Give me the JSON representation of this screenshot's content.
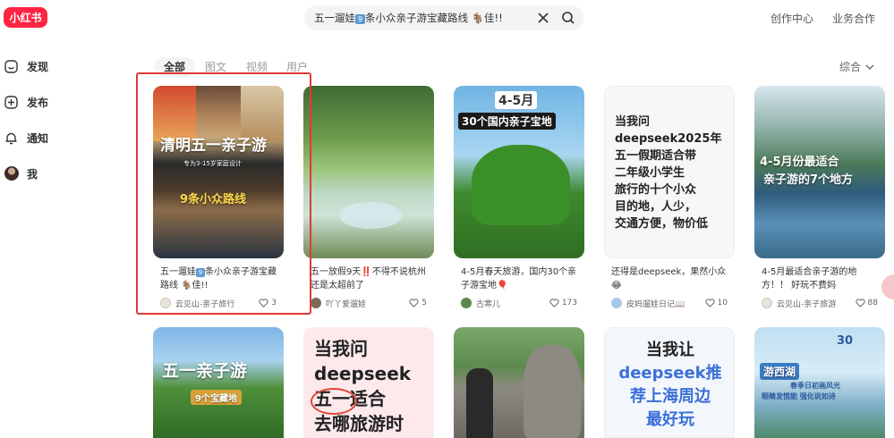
{
  "header": {
    "logo": "小红书",
    "search_value": "五一遛娃9条小众亲子游宝藏路线🐐佳!!",
    "search_value_parts": [
      "五一遛娃",
      "9",
      "条小众亲子游宝藏路线 🐐佳!!"
    ],
    "links": [
      "创作中心",
      "业务合作"
    ]
  },
  "sidebar": {
    "items": [
      {
        "label": "发现",
        "icon": "discover-icon"
      },
      {
        "label": "发布",
        "icon": "publish-icon"
      },
      {
        "label": "通知",
        "icon": "bell-icon"
      },
      {
        "label": "我",
        "icon": "avatar"
      }
    ]
  },
  "tabs": [
    "全部",
    "图文",
    "视频",
    "用户"
  ],
  "sort": "综合",
  "accent": "#ff2442",
  "cards": [
    {
      "title": "五一遛娃9条小众亲子游宝藏路线 🐐佳!!",
      "title_parts": [
        "五一遛娃",
        "9",
        "条小众亲子游宝藏路线 🐐佳!!"
      ],
      "author": "云见山-亲子旅行",
      "likes": "3",
      "thumb_text": [
        "清明五一亲子游",
        "专为3-15岁家庭设计",
        "9条小众路线"
      ]
    },
    {
      "title": "五一放假9天‼️不得不说杭州还是太超前了",
      "author": "吖丫爱遛娃",
      "likes": "5"
    },
    {
      "title": "4-5月春天旅游，国内30个亲子游宝地🎈",
      "author": "古寒儿",
      "likes": "173",
      "thumb_text": [
        "4-5月",
        "30个国内亲子宝地"
      ]
    },
    {
      "title": "还得是deepseek，果然小众😂",
      "author": "皮妈遛娃日记📖",
      "likes": "10",
      "thumb_text": [
        "当我问",
        "deepseek2025年",
        "五一假期适合带",
        "二年级小学生",
        "旅行的十个小众",
        "目的地，人少，",
        "交通方便，物价低"
      ]
    },
    {
      "title": "4-5月最适合亲子游的地方！！ 好玩不费妈",
      "author": "云见山-亲子旅游",
      "likes": "88",
      "thumb_text": [
        "4-5月份最适合",
        "亲子游的7个地方"
      ]
    },
    {
      "thumb_text": [
        "五一亲子游",
        "9个宝藏地"
      ]
    },
    {
      "thumb_text": [
        "当我问",
        "deepseek",
        "五一适合",
        "去哪旅游时"
      ]
    },
    {
      "thumb_text": []
    },
    {
      "thumb_text": [
        "当我让",
        "deepseek推",
        "荐上海周边",
        "最好玩"
      ]
    },
    {
      "thumb_text": [
        "30",
        "游西湖",
        "春季日初画风光",
        "眼睛发慌能 强化说如诗"
      ]
    }
  ]
}
